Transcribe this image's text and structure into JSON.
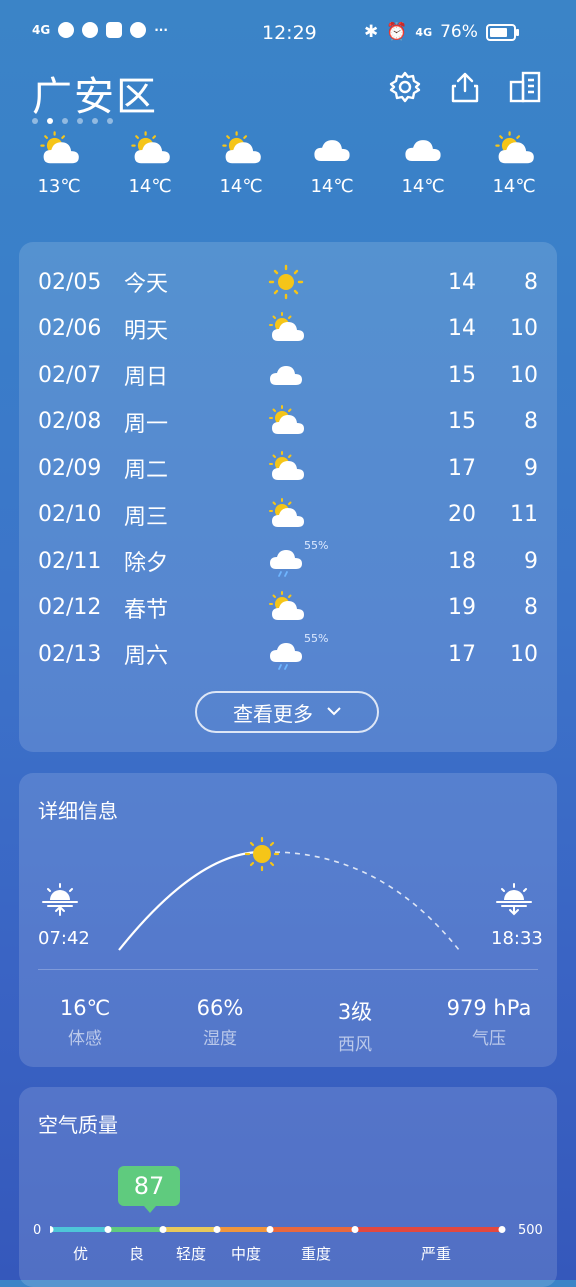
{
  "status_bar": {
    "signal": "4G",
    "time": "12:29",
    "network": "4G",
    "battery": "76%"
  },
  "header": {
    "city": "广安区",
    "icons": [
      "gear-icon",
      "share-icon",
      "city-list-icon"
    ]
  },
  "hourly": [
    {
      "icon": "partly-cloudy",
      "temp": "13℃"
    },
    {
      "icon": "partly-cloudy",
      "temp": "14℃"
    },
    {
      "icon": "partly-cloudy",
      "temp": "14℃"
    },
    {
      "icon": "cloudy",
      "temp": "14℃"
    },
    {
      "icon": "cloudy",
      "temp": "14℃"
    },
    {
      "icon": "partly-cloudy",
      "temp": "14℃"
    }
  ],
  "forecast": [
    {
      "date": "02/05",
      "day": "今天",
      "icon": "sunny",
      "pop": "",
      "high": "14",
      "low": "8"
    },
    {
      "date": "02/06",
      "day": "明天",
      "icon": "partly-cloudy",
      "pop": "",
      "high": "14",
      "low": "10"
    },
    {
      "date": "02/07",
      "day": "周日",
      "icon": "cloudy",
      "pop": "",
      "high": "15",
      "low": "10"
    },
    {
      "date": "02/08",
      "day": "周一",
      "icon": "partly-cloudy",
      "pop": "",
      "high": "15",
      "low": "8"
    },
    {
      "date": "02/09",
      "day": "周二",
      "icon": "partly-cloudy",
      "pop": "",
      "high": "17",
      "low": "9"
    },
    {
      "date": "02/10",
      "day": "周三",
      "icon": "partly-cloudy",
      "pop": "",
      "high": "20",
      "low": "11"
    },
    {
      "date": "02/11",
      "day": "除夕",
      "icon": "rain",
      "pop": "55%",
      "high": "18",
      "low": "9"
    },
    {
      "date": "02/12",
      "day": "春节",
      "icon": "partly-cloudy",
      "pop": "",
      "high": "19",
      "low": "8"
    },
    {
      "date": "02/13",
      "day": "周六",
      "icon": "rain",
      "pop": "55%",
      "high": "17",
      "low": "10"
    }
  ],
  "more_button": "查看更多",
  "details": {
    "title": "详细信息",
    "sunrise": "07:42",
    "sunset": "18:33",
    "stats": [
      {
        "value": "16℃",
        "label": "体感"
      },
      {
        "value": "66%",
        "label": "湿度"
      },
      {
        "value": "3级",
        "label": "西风"
      },
      {
        "value": "979 hPa",
        "label": "气压"
      }
    ]
  },
  "air_quality": {
    "title": "空气质量",
    "aqi": "87",
    "min": "0",
    "max": "500",
    "levels": [
      "优",
      "良",
      "轻度",
      "中度",
      "重度",
      "严重"
    ],
    "colors": [
      "#4ec6d8",
      "#5fcb7e",
      "#e8c95a",
      "#f0963c",
      "#e9683e",
      "#e2483f"
    ]
  }
}
